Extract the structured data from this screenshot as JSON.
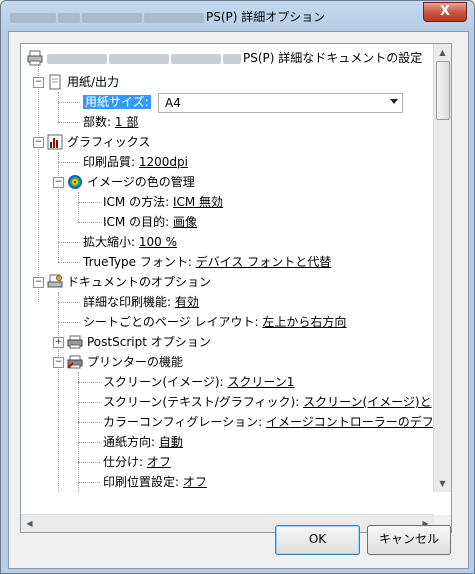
{
  "window": {
    "title_suffix": "PS(P) 詳細オプション",
    "close_label": "X"
  },
  "tree": {
    "root": {
      "label_suffix": "PS(P) 詳細なドキュメントの設定",
      "icon": "printer-icon"
    },
    "paper_output": {
      "label": "用紙/出力",
      "icon": "paper-icon",
      "paper_size": {
        "label": "用紙サイズ:",
        "value": "A4"
      },
      "copies": {
        "label": "部数:",
        "value": "1 部"
      }
    },
    "graphics": {
      "label": "グラフィックス",
      "icon": "graphics-icon",
      "print_quality": {
        "label": "印刷品質:",
        "value": "1200dpi"
      },
      "color_management": {
        "label": "イメージの色の管理",
        "icon": "color-wheel-icon",
        "icm_method": {
          "label": "ICM の方法:",
          "value": "ICM 無効"
        },
        "icm_intent": {
          "label": "ICM の目的:",
          "value": "画像"
        }
      },
      "scaling": {
        "label": "拡大縮小:",
        "value": "100 %"
      },
      "truetype": {
        "label": "TrueType フォント:",
        "value": "デバイス フォントと代替"
      }
    },
    "document_options": {
      "label": "ドキュメントのオプション",
      "icon": "document-options-icon",
      "advanced_printing": {
        "label": "詳細な印刷機能:",
        "value": "有効"
      },
      "page_layout": {
        "label": "シートごとのページ レイアウト:",
        "value": "左上から右方向"
      },
      "postscript": {
        "label": "PostScript オプション",
        "icon": "postscript-printer-icon"
      },
      "printer_features": {
        "label": "プリンターの機能",
        "icon": "printer-features-icon",
        "items": [
          {
            "label": "スクリーン(イメージ):",
            "value": "スクリーン1"
          },
          {
            "label": "スクリーン(テキスト/グラフィック):",
            "value": "スクリーン(イメージ)と"
          },
          {
            "label": "カラーコンフィグレーション:",
            "value": "イメージコントローラーのデフ"
          },
          {
            "label": "通紙方向:",
            "value": "自動"
          },
          {
            "label": "仕分け:",
            "value": "オフ"
          },
          {
            "label": "印刷位置設定:",
            "value": "オフ"
          }
        ]
      }
    }
  },
  "buttons": {
    "ok": "OK",
    "cancel": "キャンセル"
  }
}
